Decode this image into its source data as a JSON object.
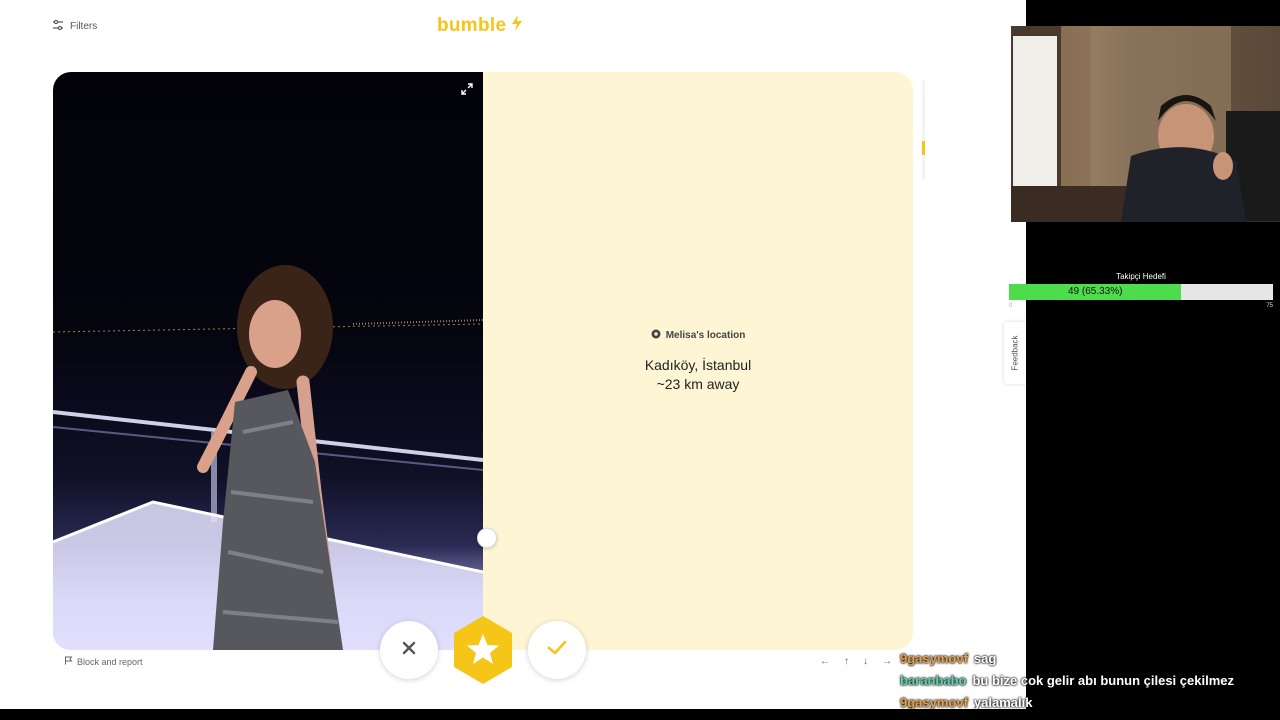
{
  "filters": {
    "label": "Filters",
    "icon": "sliders-icon"
  },
  "logo": {
    "text": "bumble",
    "color": "#f5c518"
  },
  "profile": {
    "location_label": "Melisa's location",
    "city": "Kadıköy, İstanbul",
    "distance": "~23 km away"
  },
  "actions": {
    "block_report": "Block and report",
    "pass_icon": "x-icon",
    "superswipe_icon": "star-icon",
    "like_icon": "check-icon"
  },
  "nav_arrows": [
    "←",
    "↑",
    "↓",
    "→"
  ],
  "feedback": "Feedback",
  "follower_goal": {
    "title": "Takipçi Hedefi",
    "current_label": "49 (65.33%)",
    "current": 49,
    "percent": 65.33,
    "min": "0",
    "max": "75",
    "fill_color": "#4cdc4c"
  },
  "chat": [
    {
      "user": "9gasymovf",
      "message": "sag",
      "color": "#e8a24a"
    },
    {
      "user": "baranbabo",
      "message": "bu bize cok gelir abı bunun çilesi çekilmez",
      "color": "#5fd3b0"
    },
    {
      "user": "9gasymovf",
      "message": "yalamalık",
      "color": "#e8a24a"
    }
  ],
  "colors": {
    "accent": "#f5c518",
    "panel_bg": "#fdf5d4"
  }
}
